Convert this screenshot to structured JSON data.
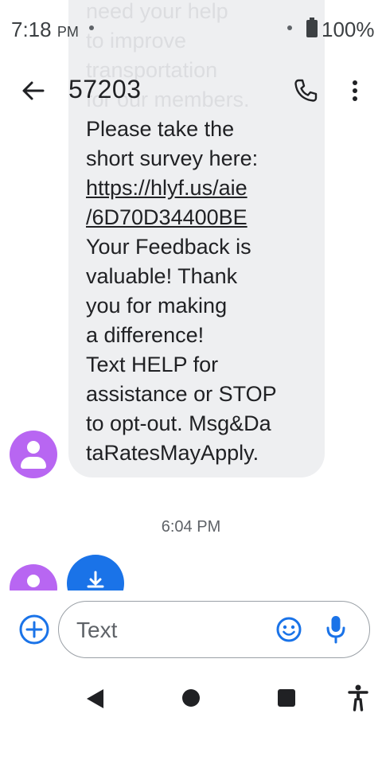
{
  "status_bar": {
    "time": "7:18",
    "ampm": "PM",
    "battery": "100%"
  },
  "app_bar": {
    "title": "57203"
  },
  "message": {
    "faded_lines": [
      "need your help",
      "to improve",
      "transportation",
      "for our members."
    ],
    "text_before_link": "Please take the\nshort survey here:\n",
    "link": "https://hlyf.us/aie\n/6D70D34400BE",
    "text_after_link": "\nYour Feedback is\nvaluable! Thank\nyou for making\na difference!\nText HELP for\nassistance or STOP\nto opt-out. Msg&Da\ntaRatesMayApply."
  },
  "timestamp": "6:04 PM",
  "compose": {
    "placeholder": "Text"
  },
  "icons": {
    "back": "arrow-back-icon",
    "call": "phone-icon",
    "more": "more-vert-icon",
    "add": "add-circle-icon",
    "emoji": "emoji-icon",
    "mic": "mic-icon",
    "download": "download-icon",
    "avatar": "person-icon"
  },
  "colors": {
    "accent": "#1a73e8",
    "avatar": "#b866f2",
    "bubble": "#eeeff1"
  }
}
